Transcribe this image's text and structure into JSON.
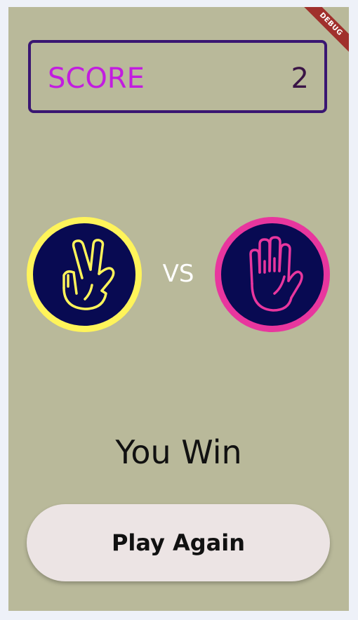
{
  "debug_banner": "DEBUG",
  "score": {
    "label": "SCORE",
    "value": "2"
  },
  "match": {
    "player_choice_icon": "scissors-hand-icon",
    "computer_choice_icon": "paper-hand-icon",
    "vs_label": "VS"
  },
  "result": {
    "text": "You Win"
  },
  "actions": {
    "play_again_label": "Play Again"
  },
  "colors": {
    "background": "#b9b99a",
    "score_border": "#3a1672",
    "score_label": "#c21ce0",
    "player_ring": "#fff45a",
    "computer_ring": "#e8369e",
    "hand_fill": "#080a52"
  }
}
